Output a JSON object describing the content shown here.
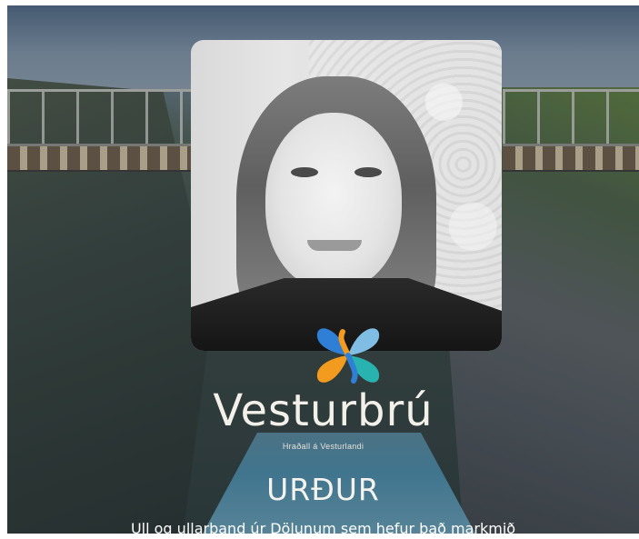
{
  "brand": {
    "name": "Vesturbrú",
    "tagline": "Hraðall á Vesturlandi"
  },
  "heading": "URÐUR",
  "subtitle": "Ull og ullarband úr Dölunum sem hefur það markmið",
  "logo_icon": "butterfly-logo-icon",
  "colors": {
    "text": "#f3f0ea",
    "logo_orange": "#f39b1f",
    "logo_blue": "#2f7fd6",
    "logo_teal": "#28b3b0",
    "logo_lightblue": "#86c6f0"
  }
}
